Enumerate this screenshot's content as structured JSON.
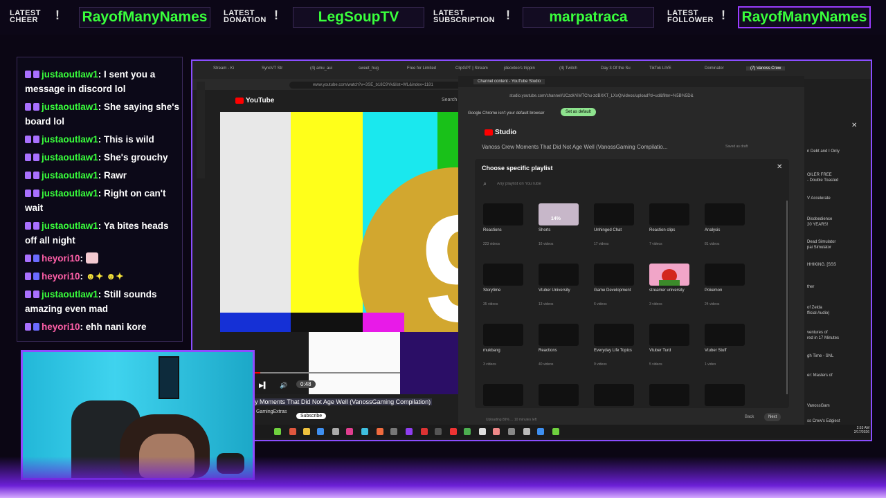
{
  "topbar": {
    "items": [
      {
        "label": "LATEST CHEER",
        "name": "RayofManyNames"
      },
      {
        "label": "LATEST DONATION",
        "name": "LegSoupTV"
      },
      {
        "label": "LATEST SUBSCRIPTION",
        "name": "marpatraca"
      },
      {
        "label": "LATEST FOLLOWER",
        "name": "RayofManyNames"
      }
    ]
  },
  "chat": {
    "messages": [
      {
        "user": "justaoutlaw1",
        "text": ": I sent you a message in discord lol"
      },
      {
        "user": "justaoutlaw1",
        "text": ": She saying she's board lol"
      },
      {
        "user": "justaoutlaw1",
        "text": ": This is wild"
      },
      {
        "user": "justaoutlaw1",
        "text": ": She's grouchy"
      },
      {
        "user": "justaoutlaw1",
        "text": ": Rawr"
      },
      {
        "user": "justaoutlaw1",
        "text": ": Right on can't wait"
      },
      {
        "user": "justaoutlaw1",
        "text": ": Ya bites heads off all night"
      },
      {
        "user": "heyori10",
        "text": ":"
      },
      {
        "user": "heyori10",
        "text": ":"
      },
      {
        "user": "justaoutlaw1",
        "text": ": Still sounds amazing even mad"
      },
      {
        "user": "heyori10",
        "text": ": ehh nani kore"
      }
    ]
  },
  "browser": {
    "address": "www.youtube.com/watch?v=3SE_b18C9Yk&list=WL&index=1181",
    "youtube_label": "YouTube",
    "video_time": "0:48",
    "video_title": "y Moments That Did Not Age Well (VanossGaming Compilation)",
    "channel": "GamingExtras",
    "subscribe": "Subscribe",
    "search_label": "Search"
  },
  "studio": {
    "tab_label": "Channel content - YouTube Studio",
    "address": "studio.youtube.com/channel/UCzdkYiMTChu-zdBXKT_LXxQ/videos/upload?d=ud&filter=%5B%5D&",
    "notice": "Google Chrome isn't your default browser",
    "set_default": "Set as default",
    "studio_label": "Studio",
    "video_title": "Vanoss Crew Moments That Did Not Age Well (VanossGaming Compilatio...",
    "save_draft": "Saved as draft",
    "modal_title": "Choose specific playlist",
    "search_placeholder": "Any playlist on YouTube",
    "playlists": [
      {
        "name": "Reactions",
        "count": "223 videos"
      },
      {
        "name": "Shorts",
        "count": "16 videos"
      },
      {
        "name": "Unhinged Chat",
        "count": "17 videos"
      },
      {
        "name": "Reaction clips",
        "count": "7 videos"
      },
      {
        "name": "Analysis",
        "count": "81 videos"
      },
      {
        "name": "Storytime",
        "count": "35 videos"
      },
      {
        "name": "Vtuber University",
        "count": "13 videos"
      },
      {
        "name": "Game Development",
        "count": "6 videos"
      },
      {
        "name": "streamer university",
        "count": "3 videos"
      },
      {
        "name": "Pokemon",
        "count": "24 videos"
      },
      {
        "name": "mukbang",
        "count": "3 videos"
      },
      {
        "name": "Reactions",
        "count": "40 videos"
      },
      {
        "name": "Everyday Life Topics",
        "count": "9 videos"
      },
      {
        "name": "Vtuber Turd",
        "count": "5 videos"
      },
      {
        "name": "Vtuber Stuff",
        "count": "1 video"
      }
    ],
    "progress_label": "14%",
    "back": "Back",
    "next": "Next",
    "uploading": "Uploading 89% ... 10 minutes left"
  },
  "sidebar_text": [
    "n Debt and I Only",
    "OILER FREE",
    "- Double Toasted",
    "V Accelerate",
    "Disobedience",
    "20 YEARS!",
    "Dead Simulator",
    "pai Simulator",
    "HHIKING. [SSS",
    "ther",
    "of Zelda",
    "fficial Audio)",
    "ventures of",
    "red in 17 Minutes",
    "gh Time - SNL",
    "er: Masters of",
    "VanossGam",
    "ss Crew's Edgiest"
  ],
  "clock": {
    "time": "2:53 AM",
    "date": "2/17/2026"
  },
  "tabs": [
    "Stream - Ki",
    "SyncVT Str",
    "(4) amu_aui",
    "sweet_hug",
    "Free for Limited",
    "ClipGPT | Stream",
    "jdeoxtoo's trippin",
    "(4) Twitch",
    "Day 3 Of the Su",
    "TikTok LIVE",
    "Dominator",
    "(7) Vanoss Crew"
  ]
}
